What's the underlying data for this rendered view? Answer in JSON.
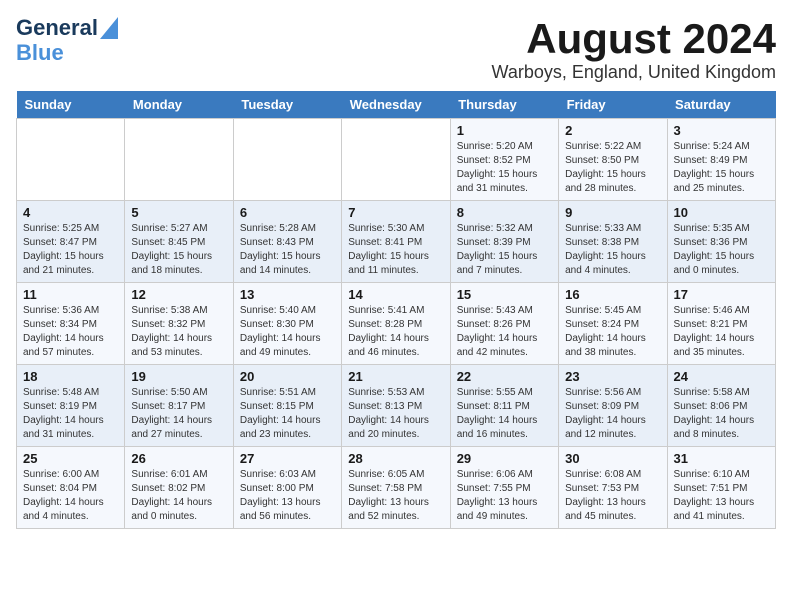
{
  "header": {
    "logo_general": "General",
    "logo_blue": "Blue",
    "month_year": "August 2024",
    "location": "Warboys, England, United Kingdom"
  },
  "weekdays": [
    "Sunday",
    "Monday",
    "Tuesday",
    "Wednesday",
    "Thursday",
    "Friday",
    "Saturday"
  ],
  "weeks": [
    [
      {
        "day": "",
        "sunrise": "",
        "sunset": "",
        "daylight": ""
      },
      {
        "day": "",
        "sunrise": "",
        "sunset": "",
        "daylight": ""
      },
      {
        "day": "",
        "sunrise": "",
        "sunset": "",
        "daylight": ""
      },
      {
        "day": "",
        "sunrise": "",
        "sunset": "",
        "daylight": ""
      },
      {
        "day": "1",
        "sunrise": "Sunrise: 5:20 AM",
        "sunset": "Sunset: 8:52 PM",
        "daylight": "Daylight: 15 hours and 31 minutes."
      },
      {
        "day": "2",
        "sunrise": "Sunrise: 5:22 AM",
        "sunset": "Sunset: 8:50 PM",
        "daylight": "Daylight: 15 hours and 28 minutes."
      },
      {
        "day": "3",
        "sunrise": "Sunrise: 5:24 AM",
        "sunset": "Sunset: 8:49 PM",
        "daylight": "Daylight: 15 hours and 25 minutes."
      }
    ],
    [
      {
        "day": "4",
        "sunrise": "Sunrise: 5:25 AM",
        "sunset": "Sunset: 8:47 PM",
        "daylight": "Daylight: 15 hours and 21 minutes."
      },
      {
        "day": "5",
        "sunrise": "Sunrise: 5:27 AM",
        "sunset": "Sunset: 8:45 PM",
        "daylight": "Daylight: 15 hours and 18 minutes."
      },
      {
        "day": "6",
        "sunrise": "Sunrise: 5:28 AM",
        "sunset": "Sunset: 8:43 PM",
        "daylight": "Daylight: 15 hours and 14 minutes."
      },
      {
        "day": "7",
        "sunrise": "Sunrise: 5:30 AM",
        "sunset": "Sunset: 8:41 PM",
        "daylight": "Daylight: 15 hours and 11 minutes."
      },
      {
        "day": "8",
        "sunrise": "Sunrise: 5:32 AM",
        "sunset": "Sunset: 8:39 PM",
        "daylight": "Daylight: 15 hours and 7 minutes."
      },
      {
        "day": "9",
        "sunrise": "Sunrise: 5:33 AM",
        "sunset": "Sunset: 8:38 PM",
        "daylight": "Daylight: 15 hours and 4 minutes."
      },
      {
        "day": "10",
        "sunrise": "Sunrise: 5:35 AM",
        "sunset": "Sunset: 8:36 PM",
        "daylight": "Daylight: 15 hours and 0 minutes."
      }
    ],
    [
      {
        "day": "11",
        "sunrise": "Sunrise: 5:36 AM",
        "sunset": "Sunset: 8:34 PM",
        "daylight": "Daylight: 14 hours and 57 minutes."
      },
      {
        "day": "12",
        "sunrise": "Sunrise: 5:38 AM",
        "sunset": "Sunset: 8:32 PM",
        "daylight": "Daylight: 14 hours and 53 minutes."
      },
      {
        "day": "13",
        "sunrise": "Sunrise: 5:40 AM",
        "sunset": "Sunset: 8:30 PM",
        "daylight": "Daylight: 14 hours and 49 minutes."
      },
      {
        "day": "14",
        "sunrise": "Sunrise: 5:41 AM",
        "sunset": "Sunset: 8:28 PM",
        "daylight": "Daylight: 14 hours and 46 minutes."
      },
      {
        "day": "15",
        "sunrise": "Sunrise: 5:43 AM",
        "sunset": "Sunset: 8:26 PM",
        "daylight": "Daylight: 14 hours and 42 minutes."
      },
      {
        "day": "16",
        "sunrise": "Sunrise: 5:45 AM",
        "sunset": "Sunset: 8:24 PM",
        "daylight": "Daylight: 14 hours and 38 minutes."
      },
      {
        "day": "17",
        "sunrise": "Sunrise: 5:46 AM",
        "sunset": "Sunset: 8:21 PM",
        "daylight": "Daylight: 14 hours and 35 minutes."
      }
    ],
    [
      {
        "day": "18",
        "sunrise": "Sunrise: 5:48 AM",
        "sunset": "Sunset: 8:19 PM",
        "daylight": "Daylight: 14 hours and 31 minutes."
      },
      {
        "day": "19",
        "sunrise": "Sunrise: 5:50 AM",
        "sunset": "Sunset: 8:17 PM",
        "daylight": "Daylight: 14 hours and 27 minutes."
      },
      {
        "day": "20",
        "sunrise": "Sunrise: 5:51 AM",
        "sunset": "Sunset: 8:15 PM",
        "daylight": "Daylight: 14 hours and 23 minutes."
      },
      {
        "day": "21",
        "sunrise": "Sunrise: 5:53 AM",
        "sunset": "Sunset: 8:13 PM",
        "daylight": "Daylight: 14 hours and 20 minutes."
      },
      {
        "day": "22",
        "sunrise": "Sunrise: 5:55 AM",
        "sunset": "Sunset: 8:11 PM",
        "daylight": "Daylight: 14 hours and 16 minutes."
      },
      {
        "day": "23",
        "sunrise": "Sunrise: 5:56 AM",
        "sunset": "Sunset: 8:09 PM",
        "daylight": "Daylight: 14 hours and 12 minutes."
      },
      {
        "day": "24",
        "sunrise": "Sunrise: 5:58 AM",
        "sunset": "Sunset: 8:06 PM",
        "daylight": "Daylight: 14 hours and 8 minutes."
      }
    ],
    [
      {
        "day": "25",
        "sunrise": "Sunrise: 6:00 AM",
        "sunset": "Sunset: 8:04 PM",
        "daylight": "Daylight: 14 hours and 4 minutes."
      },
      {
        "day": "26",
        "sunrise": "Sunrise: 6:01 AM",
        "sunset": "Sunset: 8:02 PM",
        "daylight": "Daylight: 14 hours and 0 minutes."
      },
      {
        "day": "27",
        "sunrise": "Sunrise: 6:03 AM",
        "sunset": "Sunset: 8:00 PM",
        "daylight": "Daylight: 13 hours and 56 minutes."
      },
      {
        "day": "28",
        "sunrise": "Sunrise: 6:05 AM",
        "sunset": "Sunset: 7:58 PM",
        "daylight": "Daylight: 13 hours and 52 minutes."
      },
      {
        "day": "29",
        "sunrise": "Sunrise: 6:06 AM",
        "sunset": "Sunset: 7:55 PM",
        "daylight": "Daylight: 13 hours and 49 minutes."
      },
      {
        "day": "30",
        "sunrise": "Sunrise: 6:08 AM",
        "sunset": "Sunset: 7:53 PM",
        "daylight": "Daylight: 13 hours and 45 minutes."
      },
      {
        "day": "31",
        "sunrise": "Sunrise: 6:10 AM",
        "sunset": "Sunset: 7:51 PM",
        "daylight": "Daylight: 13 hours and 41 minutes."
      }
    ]
  ]
}
